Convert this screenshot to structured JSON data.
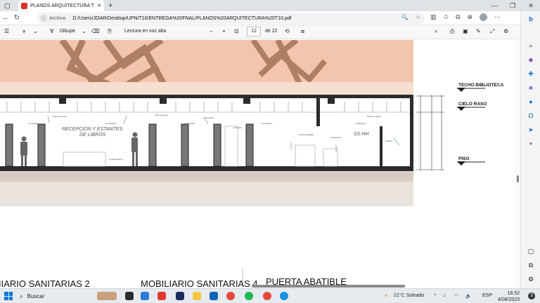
{
  "browser": {
    "tab_title": "PLANOS ARQUITECTURA T10.pdf",
    "tab_close": "✕",
    "new_tab": "+",
    "address_label": "Archivo",
    "url": "D:/Users/JOAR/Desktop/UPN/T10/ENTREGA%20FNAL/PLANOS%20ARQUITECTURA%20T10.pdf",
    "window_controls": [
      "—",
      "❐",
      "✕"
    ]
  },
  "pdf_toolbar": {
    "draw_label": "Dibujar",
    "read_aloud_label": "Lectura en voz alta",
    "zoom_out": "−",
    "zoom_in": "+",
    "page_current": "12",
    "page_total": "de 22"
  },
  "drawing": {
    "level_labels": [
      "TECHO BIBLIOTECA",
      "CIELO RASO",
      "PISO"
    ],
    "room_labels": [
      "RECEPCIÓN Y ESTANTES",
      "DE LIBROS",
      "SS.HH"
    ],
    "bottom_titles": [
      "IIARIO SANITARIAS 2",
      "MOBILIARIO SANITARIAS 4",
      "PUERTA ABATIBLE"
    ]
  },
  "taskbar": {
    "search_placeholder": "Buscar",
    "weather": "21°C Soleado",
    "language": "ESP",
    "time": "16:52",
    "date": "4/08/2023",
    "notification_count": "3"
  },
  "colors": {
    "accent": "#0078d4",
    "pdf_red": "#d8322c",
    "wall_salmon": "#f2c6ad",
    "wood": "#b07f63",
    "ground": "#d9cbc4"
  }
}
